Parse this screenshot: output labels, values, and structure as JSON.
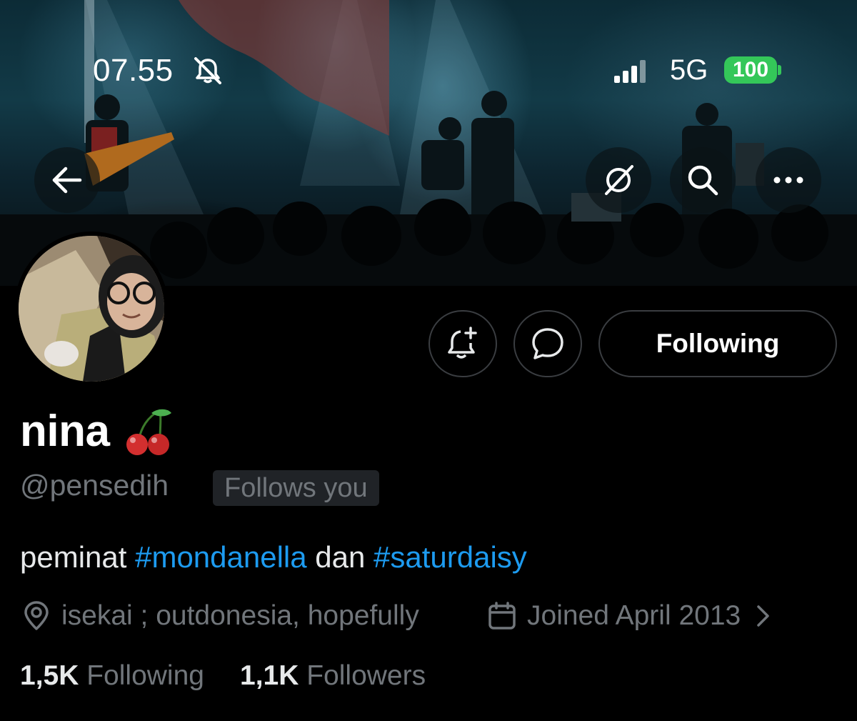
{
  "status_bar": {
    "time": "07.55",
    "network": "5G",
    "battery": "100",
    "battery_color": "#34c759"
  },
  "header": {
    "icons": [
      "back-arrow-icon",
      "grok-icon",
      "search-icon",
      "more-icon"
    ]
  },
  "profile": {
    "display_name": "nina",
    "name_emoji": "cherry-emoji",
    "handle": "@pensedih",
    "follows_you_label": "Follows you",
    "bio": {
      "text_1": "peminat ",
      "hashtag_1": "#mondanella",
      "text_2": " dan ",
      "hashtag_2": "#saturdaisy"
    },
    "location": "isekai ; outdonesia, hopefully",
    "joined": "Joined April 2013",
    "following_count": "1,5K",
    "following_label": "Following",
    "followers_count": "1,1K",
    "followers_label": "Followers"
  },
  "actions": {
    "follow_button_label": "Following",
    "icons": [
      "notification-bell-icon",
      "message-icon"
    ]
  },
  "colors": {
    "background": "#000000",
    "hashtag": "#1d9bf0",
    "secondary_text": "#71767b",
    "primary_text": "#e7e9ea"
  }
}
